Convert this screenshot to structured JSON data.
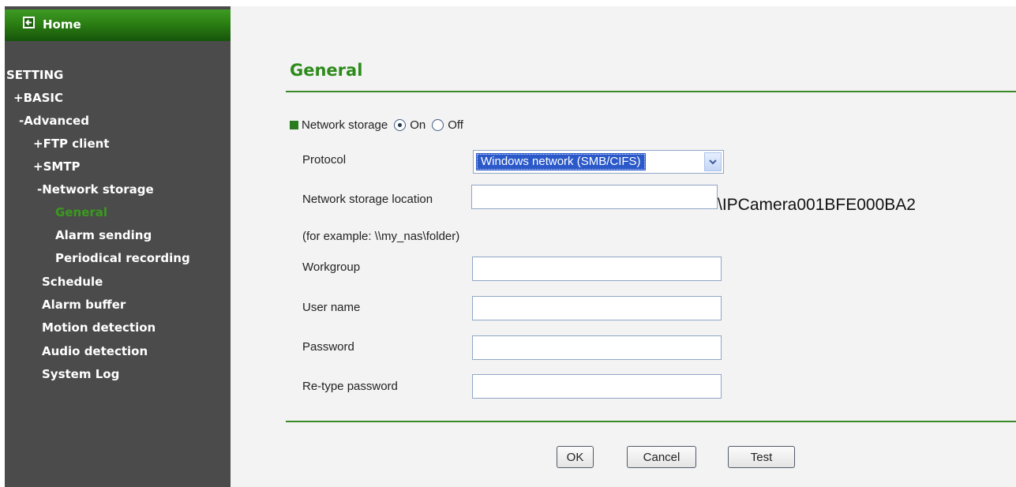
{
  "sidebar": {
    "home_label": "Home",
    "settings_heading": "SETTING",
    "items": [
      {
        "label": "+BASIC"
      },
      {
        "label": "-Advanced"
      },
      {
        "label": "+FTP client"
      },
      {
        "label": "+SMTP"
      },
      {
        "label": "-Network storage"
      },
      {
        "label": "General"
      },
      {
        "label": "Alarm sending"
      },
      {
        "label": "Periodical recording"
      },
      {
        "label": "Schedule"
      },
      {
        "label": "Alarm buffer"
      },
      {
        "label": "Motion detection"
      },
      {
        "label": "Audio detection"
      },
      {
        "label": "System Log"
      }
    ]
  },
  "main": {
    "title": "General",
    "network_storage": {
      "label": "Network storage",
      "on_label": "On",
      "off_label": "Off",
      "selected": "On"
    },
    "fields": {
      "protocol_label": "Protocol",
      "protocol_value": "Windows network (SMB/CIFS)",
      "location_label": "Network storage location",
      "location_value": "",
      "location_suffix": "\\IPCamera001BFE000BA2",
      "example_text": "(for example: \\\\my_nas\\folder)",
      "workgroup_label": "Workgroup",
      "workgroup_value": "",
      "username_label": "User name",
      "username_value": "",
      "password_label": "Password",
      "password_value": "",
      "retype_label": "Re-type password",
      "retype_value": ""
    },
    "buttons": {
      "ok": "OK",
      "cancel": "Cancel",
      "test": "Test"
    }
  },
  "colors": {
    "accent_green": "#2e8b1b",
    "sidebar_bg": "#4b4b4b",
    "select_highlight": "#2b59c9"
  }
}
